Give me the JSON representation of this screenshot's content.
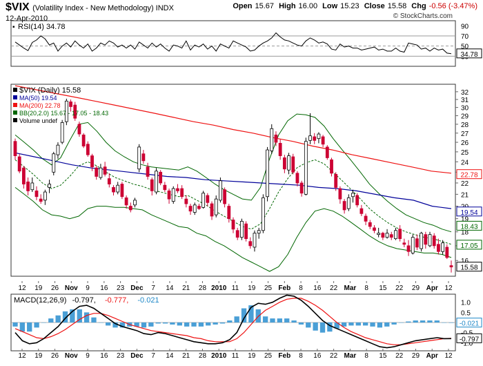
{
  "header": {
    "symbol": "$VIX",
    "name": "(Volatility Index - New Methodology)",
    "exchange": "INDX",
    "date": "12-Apr-2010",
    "open_label": "Open",
    "open": "15.67",
    "high_label": "High",
    "high": "16.00",
    "low_label": "Low",
    "low": "15.23",
    "close_label": "Close",
    "close": "15.58",
    "chg_label": "Chg",
    "chg": "-0.56 (-3.47%)",
    "credit": "© StockCharts.com"
  },
  "colors": {
    "up": "#ffffff",
    "down": "#cc0033",
    "ma50": "#000099",
    "ma200": "#ee1111",
    "bb": "#006600",
    "macd": "#000000",
    "signal": "#ee1111",
    "hist": "#4a9fd6",
    "rsi": "#000000"
  },
  "chart_data": [
    {
      "type": "line",
      "title": "RSI(14) 34.78",
      "legend": "RSI(14) 34.78",
      "yticks": [
        "30",
        "50",
        "70",
        "90"
      ],
      "ylim": [
        10,
        100
      ],
      "guides": [
        30,
        50,
        70
      ],
      "last_value": "34.78",
      "values": [
        58,
        52,
        46,
        41,
        57,
        62,
        70,
        64,
        52,
        56,
        40,
        50,
        56,
        48,
        60,
        52,
        46,
        54,
        40,
        46,
        56,
        52,
        60,
        56,
        48,
        52,
        46,
        52,
        44,
        58,
        52,
        46,
        56,
        48,
        54,
        46,
        40,
        52,
        50,
        46,
        60,
        42,
        52,
        48,
        54,
        44,
        50,
        40,
        54,
        50,
        46,
        60,
        56,
        52,
        48,
        40,
        42,
        50,
        56,
        60,
        66,
        76,
        68,
        62,
        60,
        56,
        52,
        50,
        60,
        66,
        62,
        56,
        58,
        54,
        44,
        42,
        54,
        48,
        50,
        46,
        46,
        42,
        44,
        46,
        48,
        42,
        44,
        40,
        40,
        46,
        40,
        38,
        56,
        54,
        52,
        44,
        46,
        40,
        46,
        42,
        44,
        36,
        34.78
      ]
    },
    {
      "type": "candlestick",
      "title": "$VIX (Daily) 15.58",
      "legend": [
        {
          "label": "$VIX (Daily) 15.58",
          "color": "#000000"
        },
        {
          "label": "MA(50) 19.54",
          "color": "#000099"
        },
        {
          "label": "MA(200) 22.78",
          "color": "#ee1111"
        },
        {
          "label": "BB(20,2.0) 15.67 - 17.05 - 18.43",
          "color": "#006600"
        },
        {
          "label": "Volume undef",
          "color": "#000000"
        }
      ],
      "y_scale": "log",
      "ylim": [
        15,
        33
      ],
      "yticks": [
        "16",
        "17",
        "18",
        "19",
        "20",
        "21",
        "22",
        "23",
        "24",
        "25",
        "26",
        "27",
        "28",
        "29",
        "30",
        "31",
        "32"
      ],
      "value_tags": [
        {
          "label": "22.78",
          "value": 22.78,
          "color": "#ee1111"
        },
        {
          "label": "19.54",
          "value": 19.54,
          "color": "#000099"
        },
        {
          "label": "18.43",
          "value": 18.43,
          "color": "#006600"
        },
        {
          "label": "17.05",
          "value": 17.05,
          "color": "#006600"
        },
        {
          "label": "15.58",
          "value": 15.58,
          "color": "#000000"
        }
      ],
      "x_labels": [
        "12",
        "19",
        "26",
        "Nov",
        "9",
        "16",
        "23",
        "Dec",
        "7",
        "14",
        "21",
        "28",
        "2010",
        "11",
        "19",
        "25",
        "Feb",
        "8",
        "16",
        "22",
        "Mar",
        "8",
        "15",
        "22",
        "29",
        "Apr",
        "12"
      ],
      "ohlc": [
        [
          26.1,
          26.4,
          24.2,
          24.6
        ],
        [
          24.5,
          24.8,
          22.9,
          23.1
        ],
        [
          23.4,
          23.6,
          21.5,
          21.9
        ],
        [
          22.1,
          22.5,
          20.9,
          21.3
        ],
        [
          21.4,
          22.5,
          21.2,
          22.0
        ],
        [
          21.3,
          21.7,
          20.5,
          20.8
        ],
        [
          20.6,
          21.0,
          20.2,
          20.4
        ],
        [
          20.5,
          21.4,
          20.1,
          21.2
        ],
        [
          21.6,
          22.3,
          21.1,
          21.9
        ],
        [
          23.0,
          25.0,
          22.7,
          24.8
        ],
        [
          24.7,
          26.0,
          24.3,
          25.7
        ],
        [
          26.0,
          28.5,
          25.8,
          28.2
        ],
        [
          28.3,
          31.1,
          27.9,
          30.8
        ],
        [
          30.7,
          31.0,
          29.5,
          30.1
        ],
        [
          30.3,
          30.7,
          28.4,
          28.7
        ],
        [
          28.0,
          28.3,
          26.6,
          26.9
        ],
        [
          26.8,
          27.0,
          25.4,
          25.6
        ],
        [
          25.8,
          26.1,
          24.5,
          24.7
        ],
        [
          24.6,
          24.8,
          23.1,
          23.5
        ],
        [
          23.4,
          23.6,
          22.3,
          22.6
        ],
        [
          22.5,
          23.8,
          22.3,
          23.4
        ],
        [
          23.5,
          24.0,
          22.6,
          22.8
        ],
        [
          22.4,
          22.9,
          21.6,
          21.9
        ],
        [
          21.6,
          21.8,
          20.9,
          21.2
        ],
        [
          21.2,
          22.1,
          21.0,
          21.8
        ],
        [
          21.9,
          22.1,
          20.6,
          20.8
        ],
        [
          20.7,
          20.9,
          19.8,
          20.1
        ],
        [
          20.0,
          20.3,
          19.5,
          19.7
        ],
        [
          20.1,
          20.7,
          19.9,
          20.5
        ],
        [
          23.3,
          25.8,
          23.0,
          25.5
        ],
        [
          24.8,
          25.2,
          23.8,
          24.1
        ],
        [
          23.5,
          23.9,
          22.3,
          22.6
        ],
        [
          22.3,
          22.5,
          20.9,
          21.3
        ],
        [
          21.2,
          23.4,
          21.0,
          23.1
        ],
        [
          23.0,
          23.2,
          21.8,
          22.0
        ],
        [
          21.8,
          22.1,
          21.2,
          21.4
        ],
        [
          21.3,
          21.5,
          20.2,
          20.6
        ],
        [
          20.4,
          21.7,
          20.2,
          21.5
        ],
        [
          21.5,
          21.9,
          21.1,
          21.3
        ],
        [
          21.5,
          21.8,
          20.6,
          20.8
        ],
        [
          20.6,
          20.9,
          19.9,
          20.2
        ],
        [
          20.0,
          20.2,
          19.3,
          19.6
        ],
        [
          19.5,
          20.3,
          19.3,
          20.1
        ],
        [
          20.0,
          20.2,
          19.7,
          19.8
        ],
        [
          19.9,
          21.3,
          19.8,
          21.1
        ],
        [
          20.9,
          21.1,
          20.0,
          20.3
        ],
        [
          20.2,
          20.4,
          18.9,
          19.2
        ],
        [
          19.3,
          20.9,
          19.1,
          20.6
        ],
        [
          20.5,
          22.5,
          20.3,
          22.2
        ],
        [
          21.4,
          21.6,
          19.9,
          20.2
        ],
        [
          20.0,
          20.2,
          18.7,
          19.0
        ],
        [
          18.9,
          19.1,
          17.9,
          18.2
        ],
        [
          18.1,
          18.3,
          17.4,
          17.6
        ],
        [
          17.6,
          19.0,
          17.4,
          18.8
        ],
        [
          18.6,
          18.8,
          17.3,
          17.5
        ],
        [
          17.3,
          17.6,
          16.8,
          17.0
        ],
        [
          16.9,
          18.1,
          16.6,
          17.9
        ],
        [
          17.9,
          18.3,
          17.5,
          18.1
        ],
        [
          18.1,
          21.0,
          17.9,
          20.7
        ],
        [
          20.8,
          25.5,
          20.4,
          25.2
        ],
        [
          25.1,
          28.0,
          24.8,
          27.5
        ],
        [
          26.8,
          27.2,
          25.6,
          26.0
        ],
        [
          25.9,
          26.3,
          24.2,
          24.6
        ],
        [
          24.4,
          24.7,
          22.9,
          23.3
        ],
        [
          23.2,
          24.9,
          22.8,
          24.6
        ],
        [
          24.5,
          24.8,
          22.8,
          23.0
        ],
        [
          22.9,
          23.1,
          21.7,
          22.0
        ],
        [
          22.0,
          22.2,
          20.8,
          21.1
        ],
        [
          21.0,
          26.5,
          20.9,
          26.1
        ],
        [
          26.2,
          29.3,
          25.8,
          26.7
        ],
        [
          26.6,
          27.0,
          25.8,
          26.2
        ],
        [
          26.4,
          27.1,
          25.9,
          26.9
        ],
        [
          26.6,
          26.8,
          25.5,
          25.8
        ],
        [
          25.5,
          25.7,
          24.2,
          24.4
        ],
        [
          24.2,
          24.4,
          22.6,
          22.9
        ],
        [
          22.8,
          23.0,
          21.3,
          21.6
        ],
        [
          21.5,
          21.7,
          20.2,
          20.6
        ],
        [
          20.4,
          20.6,
          19.4,
          19.7
        ],
        [
          19.8,
          21.0,
          19.6,
          20.7
        ],
        [
          20.8,
          21.4,
          20.3,
          21.1
        ],
        [
          20.9,
          21.1,
          19.9,
          20.1
        ],
        [
          19.8,
          20.1,
          19.2,
          19.4
        ],
        [
          19.2,
          19.4,
          18.5,
          18.8
        ],
        [
          18.7,
          18.9,
          18.2,
          18.4
        ],
        [
          18.3,
          18.5,
          17.9,
          18.1
        ],
        [
          17.8,
          18.3,
          17.6,
          17.9
        ],
        [
          17.9,
          18.0,
          17.4,
          17.6
        ],
        [
          17.6,
          18.2,
          17.5,
          17.9
        ],
        [
          17.8,
          18.0,
          17.4,
          17.6
        ],
        [
          17.5,
          18.3,
          17.4,
          18.1
        ],
        [
          18.2,
          18.5,
          17.3,
          17.5
        ],
        [
          17.2,
          17.5,
          16.9,
          17.1
        ],
        [
          17.0,
          17.4,
          16.3,
          16.6
        ],
        [
          16.5,
          17.8,
          16.4,
          17.6
        ],
        [
          17.5,
          17.8,
          16.7,
          16.9
        ],
        [
          16.8,
          18.0,
          16.6,
          17.9
        ],
        [
          17.8,
          18.0,
          16.8,
          17.1
        ],
        [
          17.0,
          18.0,
          16.9,
          17.8
        ],
        [
          17.7,
          17.9,
          16.8,
          17.0
        ],
        [
          17.1,
          17.5,
          16.4,
          16.6
        ],
        [
          16.6,
          17.4,
          16.4,
          17.2
        ],
        [
          16.9,
          17.1,
          16.1,
          16.2
        ],
        [
          15.67,
          16.0,
          15.23,
          15.58
        ]
      ],
      "ma50": [
        24.9,
        24.5,
        24.1,
        23.7,
        23.4,
        23.2,
        23.0,
        22.8,
        22.6,
        22.5,
        22.3,
        22.2,
        22.1,
        22.0,
        21.9,
        21.8,
        21.6,
        21.5,
        21.3,
        21.0,
        20.7,
        20.5,
        20.0,
        19.8
      ],
      "ma200": [
        32.8,
        32.3,
        31.8,
        31.3,
        30.8,
        30.3,
        29.8,
        29.3,
        28.8,
        28.3,
        27.9,
        27.4,
        27.0,
        26.5,
        26.1,
        25.6,
        25.2,
        24.7,
        24.3,
        23.9,
        23.5,
        23.1,
        22.9
      ],
      "bb_mid": [
        24.2,
        23.5,
        22.8,
        22.0,
        21.5,
        21.8,
        22.6,
        23.6,
        24.0,
        23.6,
        23.0,
        22.5,
        22.2,
        21.9,
        21.7,
        21.4,
        21.2,
        21.0,
        20.8,
        20.9,
        20.5,
        20.1,
        19.6,
        19.2,
        18.8,
        18.4,
        18.2,
        18.6,
        19.8,
        21.2,
        22.4,
        23.4,
        23.9,
        24.2,
        23.8,
        23.0,
        22.2,
        21.4,
        20.6,
        19.8,
        19.2,
        18.7,
        18.3,
        18.0,
        17.8,
        17.6,
        17.5,
        17.3,
        17.1
      ]
    },
    {
      "type": "line",
      "title": "MACD(12,26,9) -0.797, -0.777, -0.021",
      "legend": [
        {
          "label": "MACD(12,26,9)",
          "color": "#000000"
        },
        {
          "label": "-0.797,",
          "color": "#000000"
        },
        {
          "label": "-0.777,",
          "color": "#ee1111"
        },
        {
          "label": "-0.021",
          "color": "#1e88c8"
        }
      ],
      "ylim": [
        -1.4,
        1.4
      ],
      "yticks": [
        "1.0",
        "0.5",
        "-0.5",
        "-1.0"
      ],
      "value_tags": [
        {
          "label": "-0.021",
          "value": -0.021,
          "color": "#1e88c8"
        },
        {
          "label": "-0.797",
          "value": -0.797,
          "color": "#000000"
        }
      ],
      "x_labels": [
        "12",
        "19",
        "26",
        "Nov",
        "9",
        "16",
        "23",
        "Dec",
        "7",
        "14",
        "21",
        "28",
        "2010",
        "11",
        "19",
        "25",
        "Feb",
        "8",
        "16",
        "22",
        "Mar",
        "8",
        "15",
        "22",
        "29",
        "Apr",
        "12"
      ],
      "macd": [
        -0.5,
        -0.9,
        -1.05,
        -1.0,
        -0.8,
        -0.5,
        -0.2,
        0.2,
        0.55,
        0.8,
        0.85,
        0.7,
        0.45,
        0.2,
        -0.05,
        -0.2,
        -0.3,
        -0.4,
        -0.55,
        -0.6,
        -0.5,
        -0.55,
        -0.65,
        -0.75,
        -0.85,
        -0.95,
        -1.0,
        -1.05,
        -1.05,
        -1.0,
        -0.85,
        -0.5,
        0.2,
        0.75,
        0.95,
        0.9,
        1.0,
        1.2,
        1.35,
        1.3,
        1.1,
        0.8,
        0.45,
        0.1,
        -0.15,
        -0.3,
        -0.45,
        -0.6,
        -0.75,
        -0.9,
        -1.05,
        -1.2,
        -1.25,
        -1.2,
        -1.1,
        -1.0,
        -0.9,
        -0.85,
        -0.8,
        -0.75,
        -0.8,
        -0.797
      ],
      "signal": [
        -0.3,
        -0.45,
        -0.6,
        -0.75,
        -0.8,
        -0.7,
        -0.55,
        -0.35,
        -0.1,
        0.15,
        0.35,
        0.45,
        0.45,
        0.35,
        0.2,
        0.05,
        -0.1,
        -0.2,
        -0.3,
        -0.4,
        -0.45,
        -0.5,
        -0.55,
        -0.6,
        -0.65,
        -0.75,
        -0.8,
        -0.9,
        -0.95,
        -0.95,
        -0.95,
        -0.8,
        -0.5,
        -0.1,
        0.3,
        0.6,
        0.8,
        1.0,
        1.15,
        1.2,
        1.2,
        1.05,
        0.85,
        0.6,
        0.3,
        0.0,
        -0.25,
        -0.45,
        -0.6,
        -0.75,
        -0.85,
        -0.95,
        -1.05,
        -1.1,
        -1.1,
        -1.05,
        -1.0,
        -0.95,
        -0.9,
        -0.85,
        -0.8,
        -0.777
      ]
    }
  ]
}
